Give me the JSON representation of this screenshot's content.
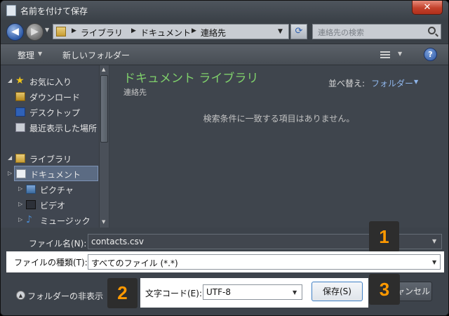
{
  "window": {
    "title": "名前を付けて保存",
    "close": "✕"
  },
  "address": {
    "crumbs": [
      "ライブラリ",
      "ドキュメント",
      "連絡先"
    ],
    "search_placeholder": "連絡先の検索"
  },
  "toolbar": {
    "organize": "整理",
    "new_folder": "新しいフォルダー",
    "help": "?"
  },
  "nav": {
    "items": [
      {
        "label": "お気に入り",
        "icon": "star-icon"
      },
      {
        "label": "ダウンロード",
        "icon": "download-folder-icon"
      },
      {
        "label": "デスクトップ",
        "icon": "desktop-icon"
      },
      {
        "label": "最近表示した場所",
        "icon": "recent-places-icon"
      },
      {
        "label": "ライブラリ",
        "icon": "library-icon"
      },
      {
        "label": "ドキュメント",
        "icon": "document-icon",
        "selected": true
      },
      {
        "label": "ピクチャ",
        "icon": "pictures-icon"
      },
      {
        "label": "ビデオ",
        "icon": "video-icon"
      },
      {
        "label": "ミュージック",
        "icon": "music-icon"
      }
    ]
  },
  "content": {
    "library_title": "ドキュメント ライブラリ",
    "library_subtitle": "連絡先",
    "sort_label": "並べ替え:",
    "sort_value": "フォルダー",
    "empty_message": "検索条件に一致する項目はありません。"
  },
  "form": {
    "filename_label": "ファイル名(N):",
    "filename_value": "contacts.csv",
    "filetype_label": "ファイルの種類(T):",
    "filetype_value": "すべてのファイル (*.*)",
    "hide_folders": "フォルダーの非表示",
    "encoding_label": "文字コード(E):",
    "encoding_value": "UTF-8",
    "save": "保存(S)",
    "cancel": "キャンセル"
  },
  "callouts": [
    "1",
    "2",
    "3"
  ],
  "colors": {
    "library_title": "#7fd06b",
    "sort_link": "#8fb6ec",
    "callout_number": "#ff9900"
  }
}
